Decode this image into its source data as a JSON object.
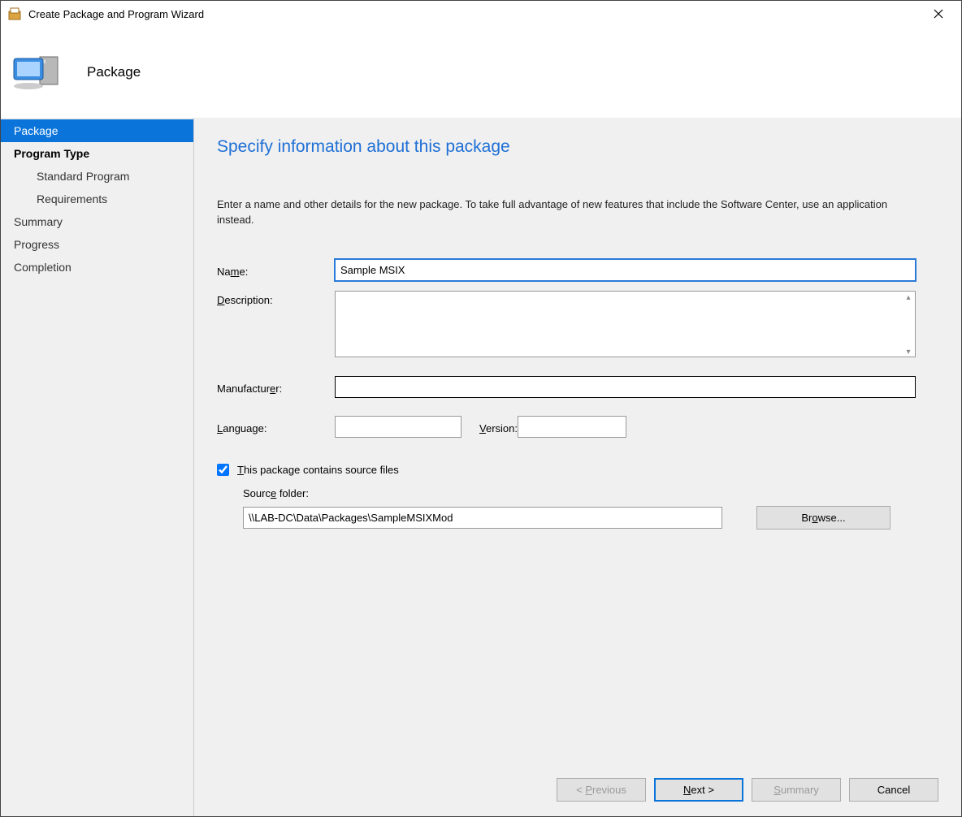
{
  "window": {
    "title": "Create Package and Program Wizard"
  },
  "header": {
    "title": "Package"
  },
  "sidebar": {
    "items": [
      {
        "label": "Package",
        "active": true
      },
      {
        "label": "Program Type",
        "bold": true
      },
      {
        "label": "Standard Program",
        "sub": true
      },
      {
        "label": "Requirements",
        "sub": true
      },
      {
        "label": "Summary"
      },
      {
        "label": "Progress"
      },
      {
        "label": "Completion"
      }
    ]
  },
  "main": {
    "heading": "Specify information about this package",
    "instructions": "Enter a name and other details for the new package. To take full advantage of new features that include the Software Center, use an application instead.",
    "name_label_pre": "Na",
    "name_label_u": "m",
    "name_label_post": "e:",
    "name_value": "Sample MSIX",
    "desc_label_u": "D",
    "desc_label_post": "escription:",
    "desc_value": "",
    "mfr_label_pre": "Manufactur",
    "mfr_label_u": "e",
    "mfr_label_post": "r:",
    "mfr_value": "",
    "lang_label_u": "L",
    "lang_label_post": "anguage:",
    "lang_value": "",
    "ver_label_u": "V",
    "ver_label_post": "ersion:",
    "ver_value": "",
    "chk_label_u": "T",
    "chk_label_post": "his package contains source files",
    "chk_checked": true,
    "src_label_pre": "Sourc",
    "src_label_u": "e",
    "src_label_post": " folder:",
    "src_value": "\\\\LAB-DC\\Data\\Packages\\SampleMSIXMod",
    "browse_label_pre": "Br",
    "browse_label_u": "o",
    "browse_label_post": "wse..."
  },
  "footer": {
    "prev_pre": "< ",
    "prev_u": "P",
    "prev_post": "revious",
    "next_u": "N",
    "next_post": "ext >",
    "summary_u": "S",
    "summary_post": "ummary",
    "cancel": "Cancel"
  }
}
